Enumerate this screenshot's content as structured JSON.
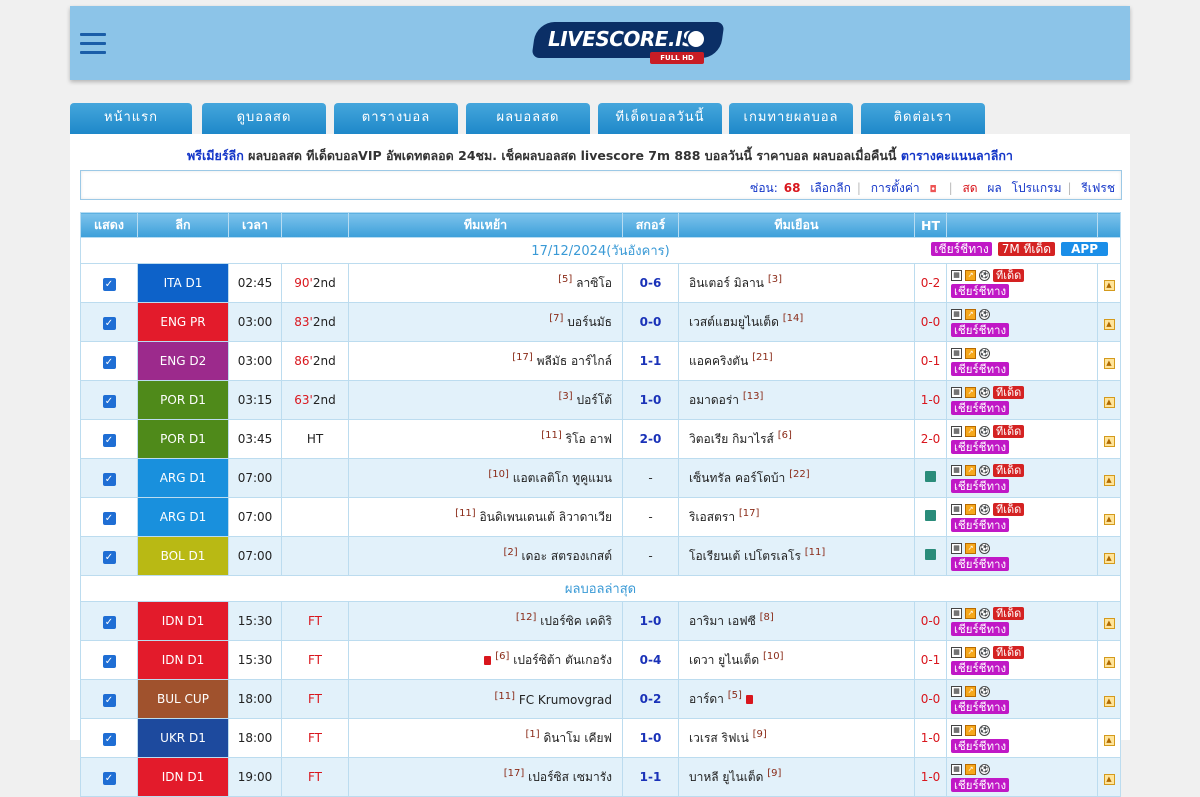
{
  "header": {
    "logo_text": "LIVESCORE.IS",
    "logo_sub": "FULL HD"
  },
  "nav": [
    {
      "label": "หน้าแรก"
    },
    {
      "label": "ดูบอลสด"
    },
    {
      "label": "ตารางบอล"
    },
    {
      "label": "ผลบอลสด"
    },
    {
      "label": "ทีเด็ดบอลวันนี้"
    },
    {
      "label": "เกมทายผลบอล"
    },
    {
      "label": "ติดต่อเรา"
    }
  ],
  "marquee": {
    "link1": "พรีเมียร์ลีก",
    "text": " ผลบอลสด ทีเด็ดบอลVIP อัพเดทตลอด 24ชม. เช็คผลบอลสด livescore 7m 888 บอลวันนี้ ราคาบอล ผลบอลเมื่อคืนนี้ ",
    "link2": "ตารางคะแนนลาลีกา"
  },
  "toolbar": {
    "hidden_label": "ซ่อน:",
    "hidden_count": "68",
    "select_league": "เลือกลีก",
    "settings": "การตั้งค่า",
    "live": "สด",
    "result": "ผล",
    "program": "โปรแกรม",
    "refresh": "รีเฟรช"
  },
  "table": {
    "headers": {
      "show": "แสดง",
      "league": "ลีก",
      "time": "เวลา",
      "status": "",
      "home": "ทีมเหย้า",
      "score": "สกอร์",
      "away": "ทีมเยือน",
      "ht": "HT",
      "odds": "",
      "last": ""
    },
    "date_label": "17/12/2024(วันอังคาร)",
    "date_buttons": {
      "cheer": "เชียร์ชีทาง",
      "tips": "7M ทีเด็ด",
      "app": "APP"
    },
    "latest_label": "ผลบอลล่าสุด",
    "tip_label": "ทีเด็ด",
    "cheer_label": "เชียร์ชีทาง",
    "section1": [
      {
        "league": "ITA D1",
        "color": "#0d62c9",
        "time": "02:45",
        "status_min": "90'",
        "status_half": "2nd",
        "home_rank": "[5]",
        "home": "ลาซิโอ",
        "score": "0-6",
        "away": "อินเตอร์ มิลาน",
        "away_rank": "[3]",
        "ht": "0-2",
        "tip": true,
        "alt": false
      },
      {
        "league": "ENG PR",
        "color": "#e31b2b",
        "time": "03:00",
        "status_min": "83'",
        "status_half": "2nd",
        "home_rank": "[7]",
        "home": "บอร์นมัธ",
        "score": "0-0",
        "away": "เวสต์แฮมยูไนเต็ด",
        "away_rank": "[14]",
        "ht": "0-0",
        "tip": false,
        "alt": true
      },
      {
        "league": "ENG D2",
        "color": "#9c2a8c",
        "time": "03:00",
        "status_min": "86'",
        "status_half": "2nd",
        "home_rank": "[17]",
        "home": "พลีมัธ อาร์ไกล์",
        "score": "1-1",
        "away": "แอคคริงตัน",
        "away_rank": "[21]",
        "ht": "0-1",
        "tip": false,
        "alt": false
      },
      {
        "league": "POR D1",
        "color": "#4f8a1a",
        "time": "03:15",
        "status_min": "63'",
        "status_half": "2nd",
        "home_rank": "[3]",
        "home": "ปอร์โต้",
        "score": "1-0",
        "away": "อมาดอร่า",
        "away_rank": "[13]",
        "ht": "1-0",
        "tip": true,
        "alt": true
      },
      {
        "league": "POR D1",
        "color": "#4f8a1a",
        "time": "03:45",
        "status_min": "",
        "status_half": "HT",
        "home_rank": "[11]",
        "home": "ริโอ อาฟ",
        "score": "2-0",
        "away": "วิตอเรีย กิมาไรส์",
        "away_rank": "[6]",
        "ht": "2-0",
        "tip": true,
        "alt": false
      },
      {
        "league": "ARG D1",
        "color": "#1990dd",
        "time": "07:00",
        "status_min": "",
        "status_half": "",
        "home_rank": "[10]",
        "home": "แอตเลติโก ทูคูแมน",
        "score": "-",
        "away": "เซ็นทรัล คอร์โดบ้า",
        "away_rank": "[22]",
        "ht": "",
        "tip": true,
        "alt": true,
        "tv": true
      },
      {
        "league": "ARG D1",
        "color": "#1990dd",
        "time": "07:00",
        "status_min": "",
        "status_half": "",
        "home_rank": "[11]",
        "home": "อินดิเพนเดนเต้ ลิวาดาเวีย",
        "score": "-",
        "away": "ริเอสตรา",
        "away_rank": "[17]",
        "ht": "",
        "tip": true,
        "alt": false,
        "tv": true
      },
      {
        "league": "BOL D1",
        "color": "#b9b914",
        "time": "07:00",
        "status_min": "",
        "status_half": "",
        "home_rank": "[2]",
        "home": "เดอะ สตรองเกสต์",
        "score": "-",
        "away": "โอเรียนเต้ เปโตรเลโร",
        "away_rank": "[11]",
        "ht": "",
        "tip": false,
        "alt": true,
        "tv": true
      }
    ],
    "section2": [
      {
        "league": "IDN D1",
        "color": "#e31b2b",
        "time": "15:30",
        "status_half": "FT",
        "home_rank": "[12]",
        "home": "เปอร์ซิค เคดิริ",
        "score": "1-0",
        "away": "อาริมา เอฟซี",
        "away_rank": "[8]",
        "ht": "0-0",
        "tip": true,
        "alt": true,
        "home_card": false,
        "away_card": false
      },
      {
        "league": "IDN D1",
        "color": "#e31b2b",
        "time": "15:30",
        "status_half": "FT",
        "home_rank": "[6]",
        "home": "เปอร์ซิต้า ตันเกอรัง",
        "score": "0-4",
        "away": "เดวา ยูไนเต็ด",
        "away_rank": "[10]",
        "ht": "0-1",
        "tip": true,
        "alt": false,
        "home_card": true,
        "away_card": false
      },
      {
        "league": "BUL CUP",
        "color": "#a0522d",
        "time": "18:00",
        "status_half": "FT",
        "home_rank": "[11]",
        "home": "FC Krumovgrad",
        "score": "0-2",
        "away": "อาร์ดา",
        "away_rank": "[5]",
        "ht": "0-0",
        "tip": false,
        "alt": true,
        "home_card": false,
        "away_card": true
      },
      {
        "league": "UKR D1",
        "color": "#1d4a9e",
        "time": "18:00",
        "status_half": "FT",
        "home_rank": "[1]",
        "home": "ดินาโม เคียฟ",
        "score": "1-0",
        "away": "เวเรส ริฟเน่",
        "away_rank": "[9]",
        "ht": "1-0",
        "tip": false,
        "alt": false,
        "home_card": false,
        "away_card": false
      },
      {
        "league": "IDN D1",
        "color": "#e31b2b",
        "time": "19:00",
        "status_half": "FT",
        "home_rank": "[17]",
        "home": "เปอร์ซิส เซมารัง",
        "score": "1-1",
        "away": "บาหลี ยูไนเต็ด",
        "away_rank": "[9]",
        "ht": "1-0",
        "tip": false,
        "alt": true,
        "home_card": false,
        "away_card": false
      }
    ]
  }
}
